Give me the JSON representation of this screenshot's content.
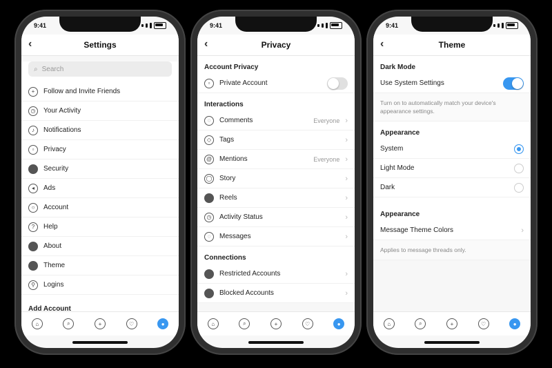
{
  "status": {
    "time": "9:41"
  },
  "phones": [
    {
      "title": "Settings",
      "search_placeholder": "Search",
      "items": [
        {
          "label": "Follow and Invite Friends",
          "icon": "add-person-icon"
        },
        {
          "label": "Your Activity",
          "icon": "activity-icon"
        },
        {
          "label": "Notifications",
          "icon": "bell-icon"
        },
        {
          "label": "Privacy",
          "icon": "lock-icon"
        },
        {
          "label": "Security",
          "icon": "shield-icon"
        },
        {
          "label": "Ads",
          "icon": "megaphone-icon"
        },
        {
          "label": "Account",
          "icon": "person-icon"
        },
        {
          "label": "Help",
          "icon": "help-icon"
        },
        {
          "label": "About",
          "icon": "info-icon"
        },
        {
          "label": "Theme",
          "icon": "theme-icon"
        },
        {
          "label": "Logins",
          "icon": "key-icon"
        }
      ],
      "footer": "Add Account"
    },
    {
      "title": "Privacy",
      "sections": [
        {
          "header": "Account Privacy",
          "items": [
            {
              "label": "Private Account",
              "icon": "lock-icon",
              "toggle": false
            }
          ]
        },
        {
          "header": "Interactions",
          "items": [
            {
              "label": "Comments",
              "icon": "comment-icon",
              "value": "Everyone"
            },
            {
              "label": "Tags",
              "icon": "tag-icon",
              "value": ""
            },
            {
              "label": "Mentions",
              "icon": "at-icon",
              "value": "Everyone"
            },
            {
              "label": "Story",
              "icon": "story-icon",
              "value": ""
            },
            {
              "label": "Reels",
              "icon": "reels-icon",
              "value": ""
            },
            {
              "label": "Activity Status",
              "icon": "activity-status-icon",
              "value": ""
            },
            {
              "label": "Messages",
              "icon": "message-icon",
              "value": ""
            }
          ]
        },
        {
          "header": "Connections",
          "items": [
            {
              "label": "Restricted Accounts",
              "icon": "restricted-icon",
              "value": ""
            },
            {
              "label": "Blocked Accounts",
              "icon": "blocked-icon",
              "value": ""
            }
          ]
        }
      ]
    },
    {
      "title": "Theme",
      "dark_section": {
        "header": "Dark Mode",
        "toggle_label": "Use System Settings",
        "toggle_on": true,
        "note": "Turn on to automatically match your device's appearance settings."
      },
      "appearance_section": {
        "header": "Appearance",
        "options": [
          {
            "label": "System",
            "selected": true
          },
          {
            "label": "Light Mode",
            "selected": false
          },
          {
            "label": "Dark",
            "selected": false
          }
        ]
      },
      "other_section": {
        "header": "Appearance",
        "row_label": "Message Theme Colors",
        "note": "Applies to message threads only."
      }
    }
  ],
  "colors": {
    "accent": "#3897f0",
    "background": "#000000"
  }
}
